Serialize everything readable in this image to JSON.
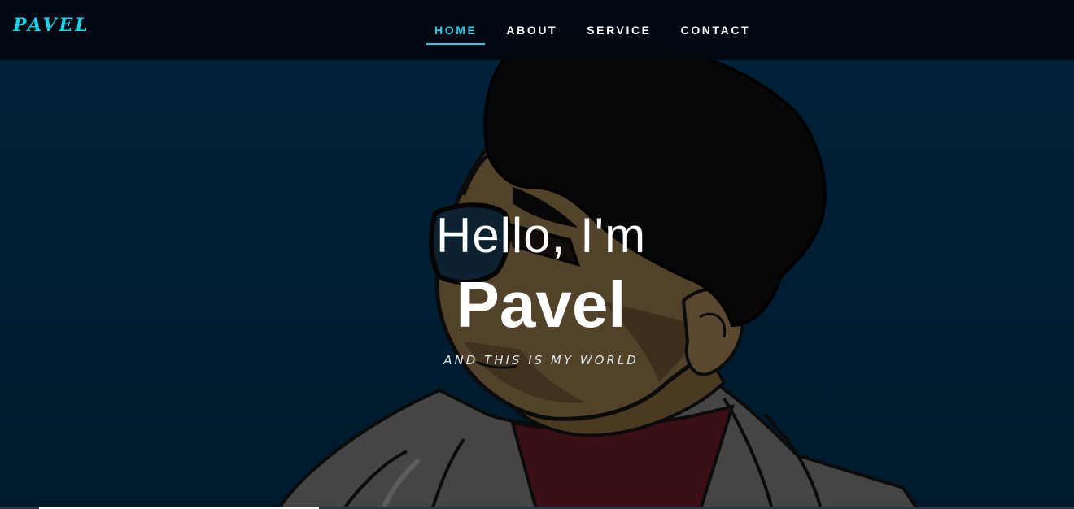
{
  "brand": {
    "logo_text": "PAVEL",
    "accent_color": "#27d3ea"
  },
  "nav": {
    "items": [
      {
        "label": "HOME",
        "active": true
      },
      {
        "label": "ABOUT",
        "active": false
      },
      {
        "label": "SERVICE",
        "active": false
      },
      {
        "label": "CONTACT",
        "active": false
      }
    ]
  },
  "hero": {
    "greeting": "Hello, I'm",
    "name": "Pavel",
    "tagline": "AND THIS IS MY WORLD",
    "background_image": "stylized-portrait-illustration"
  }
}
